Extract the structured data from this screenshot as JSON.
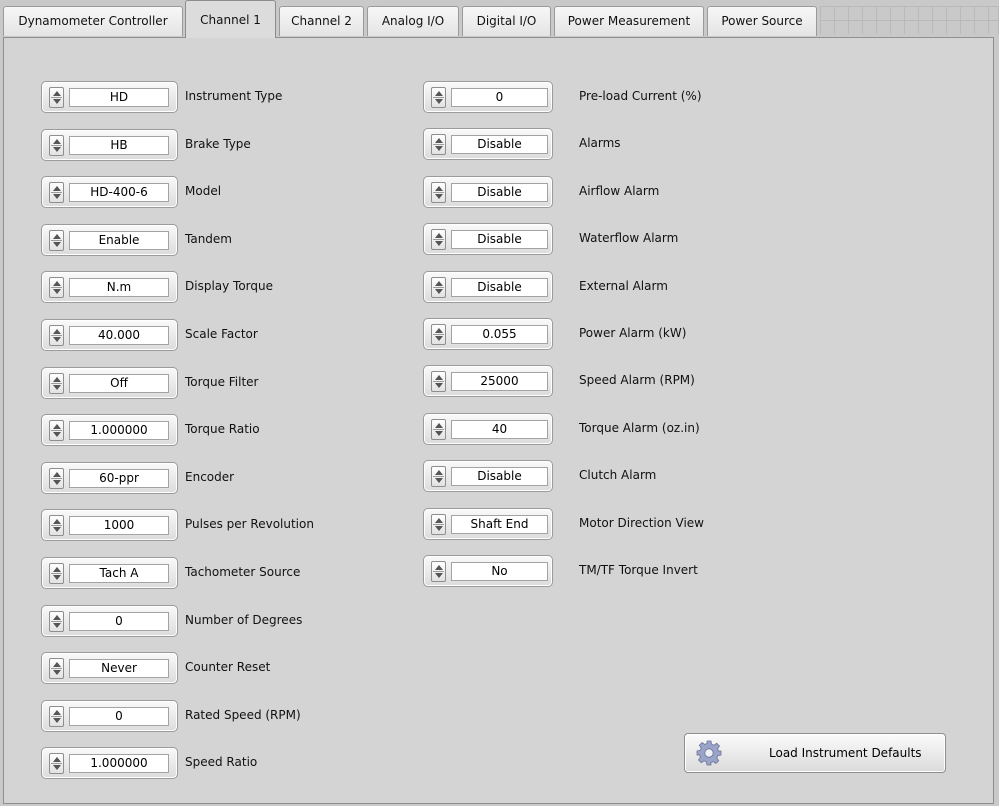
{
  "tabs": [
    {
      "label": "Dynamometer Controller",
      "active": false
    },
    {
      "label": "Channel 1",
      "active": true
    },
    {
      "label": "Channel 2",
      "active": false
    },
    {
      "label": "Analog I/O",
      "active": false
    },
    {
      "label": "Digital I/O",
      "active": false
    },
    {
      "label": "Power Measurement",
      "active": false
    },
    {
      "label": "Power Source",
      "active": false
    }
  ],
  "left_fields": [
    {
      "label": "Instrument Type",
      "value": "HD"
    },
    {
      "label": "Brake Type",
      "value": "HB"
    },
    {
      "label": "Model",
      "value": "HD-400-6"
    },
    {
      "label": "Tandem",
      "value": "Enable"
    },
    {
      "label": "Display Torque",
      "value": "N.m"
    },
    {
      "label": "Scale Factor",
      "value": "40.000"
    },
    {
      "label": "Torque Filter",
      "value": "Off"
    },
    {
      "label": "Torque Ratio",
      "value": "1.000000"
    },
    {
      "label": "Encoder",
      "value": "60-ppr"
    },
    {
      "label": "Pulses per Revolution",
      "value": "1000"
    },
    {
      "label": "Tachometer Source",
      "value": "Tach A"
    },
    {
      "label": "Number of Degrees",
      "value": "0"
    },
    {
      "label": "Counter Reset",
      "value": "Never"
    },
    {
      "label": "Rated Speed (RPM)",
      "value": "0"
    },
    {
      "label": "Speed Ratio",
      "value": "1.000000"
    }
  ],
  "right_fields": [
    {
      "label": "Pre-load Current (%)",
      "value": "0"
    },
    {
      "label": "Alarms",
      "value": "Disable"
    },
    {
      "label": "Airflow Alarm",
      "value": "Disable"
    },
    {
      "label": "Waterflow Alarm",
      "value": "Disable"
    },
    {
      "label": "External Alarm",
      "value": "Disable"
    },
    {
      "label": "Power Alarm (kW)",
      "value": "0.055"
    },
    {
      "label": "Speed Alarm (RPM)",
      "value": "25000"
    },
    {
      "label": "Torque Alarm (oz.in)",
      "value": "40"
    },
    {
      "label": "Clutch Alarm",
      "value": "Disable"
    },
    {
      "label": "Motor Direction View",
      "value": "Shaft End"
    },
    {
      "label": "TM/TF Torque Invert",
      "value": "No"
    }
  ],
  "load_defaults_button": {
    "label": "Load Instrument Defaults",
    "icon": "gear-icon"
  }
}
